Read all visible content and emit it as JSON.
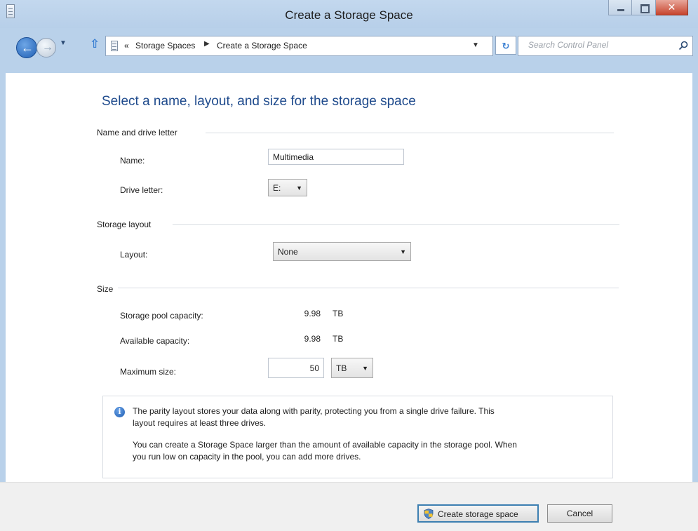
{
  "window": {
    "title": "Create a Storage Space"
  },
  "nav": {
    "breadcrumb_overflow": "«",
    "breadcrumb": [
      "Storage Spaces",
      "Create a Storage Space"
    ],
    "search_placeholder": "Search Control Panel"
  },
  "page": {
    "heading": "Select a name, layout, and size for the storage space"
  },
  "sections": {
    "name": {
      "title": "Name and drive letter",
      "name_label": "Name:",
      "name_value": "Multimedia",
      "drive_label": "Drive letter:",
      "drive_value": "E:"
    },
    "layout": {
      "title": "Storage layout",
      "layout_label": "Layout:",
      "layout_value": "None"
    },
    "size": {
      "title": "Size",
      "pool_label": "Storage pool capacity:",
      "pool_value": "9.98",
      "pool_unit": "TB",
      "available_label": "Available capacity:",
      "available_value": "9.98",
      "available_unit": "TB",
      "max_label": "Maximum size:",
      "max_value": "50",
      "max_unit": "TB"
    }
  },
  "info": {
    "line1": "The parity layout stores your data along with parity, protecting you from a single drive failure. This",
    "line2": "layout requires at least three drives.",
    "line3": "You can create a Storage Space larger than the amount of available capacity in the storage pool. When",
    "line4": "you run low on capacity in the pool, you can add more drives."
  },
  "buttons": {
    "create": "Create storage space",
    "cancel": "Cancel"
  },
  "colors": {
    "heading": "#1e4a8c",
    "chrome": "#b9d1ea",
    "footer": "#f0f0f0"
  },
  "icons": [
    "window-system-icon",
    "back-arrow-icon",
    "forward-arrow-icon",
    "up-arrow-icon",
    "control-panel-icon",
    "refresh-icon",
    "search-icon",
    "info-icon",
    "uac-shield-icon"
  ]
}
